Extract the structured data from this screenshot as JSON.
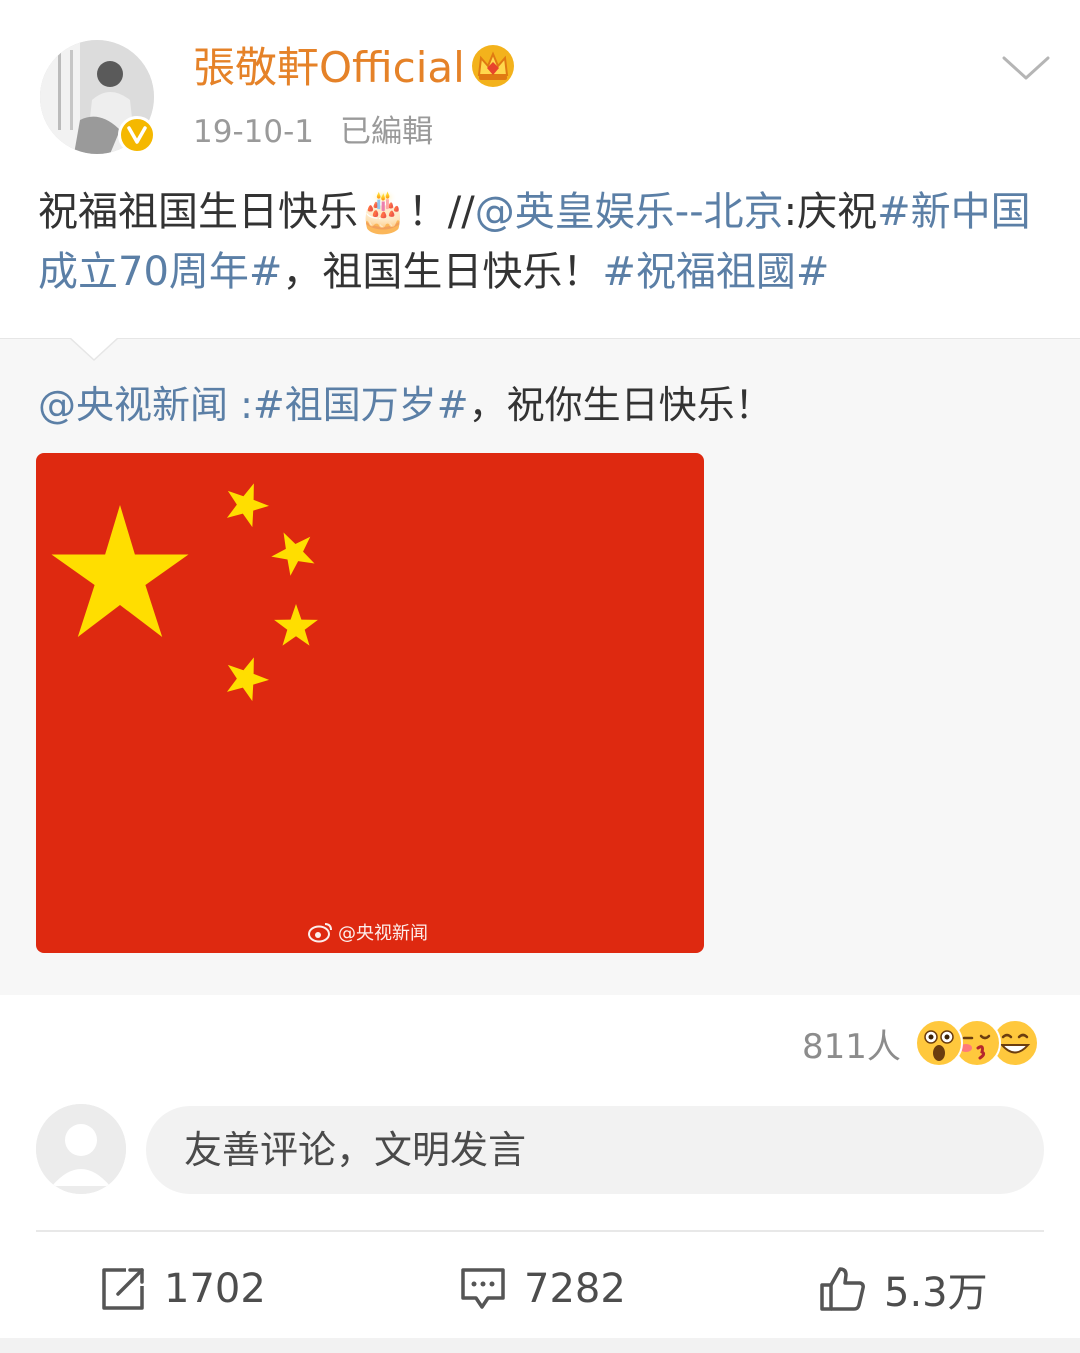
{
  "post": {
    "author": "張敬軒Official",
    "date": "19-10-1",
    "edited": "已編輯",
    "text_intro": "祝福祖国生日快乐",
    "text_emoji": "🎂",
    "text_excl": "！//",
    "mention1": "@英皇娱乐--北京",
    "text_mid": ":庆祝",
    "hashtag1": "#新中国成立70周年#",
    "text_after": "，祖国生日快乐！",
    "hashtag2": "#祝福祖國#"
  },
  "repost": {
    "mention": "@央视新闻",
    "sep": " :",
    "hashtag": "#祖国万岁#",
    "text": "，祝你生日快乐！",
    "watermark": "@央视新闻"
  },
  "reactions": {
    "count": "811人",
    "emojis": [
      "surprised-emoji",
      "kiss-emoji",
      "grin-emoji"
    ]
  },
  "comment": {
    "placeholder": "友善评论，文明发言"
  },
  "actions": {
    "repost_count": "1702",
    "comment_count": "7282",
    "like_count": "5.3万"
  },
  "colors": {
    "author": "#e58228",
    "link": "#5b7fa6",
    "flag_red": "#de2910",
    "flag_yellow": "#ffde00"
  }
}
